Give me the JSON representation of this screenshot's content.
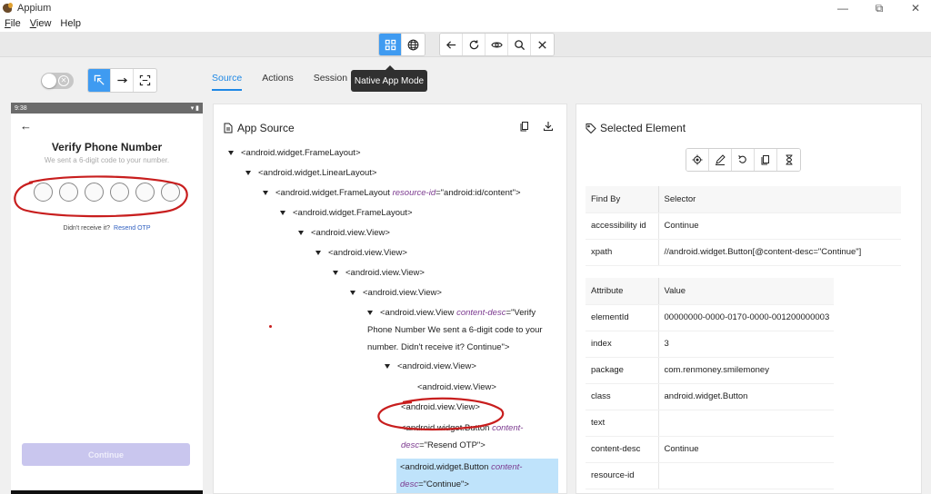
{
  "window": {
    "title": "Appium"
  },
  "menu": [
    {
      "accel": "F",
      "rest": "ile"
    },
    {
      "accel": "V",
      "rest": "iew"
    },
    {
      "accel": "",
      "rest": "Help"
    }
  ],
  "toolbar": {
    "tooltip": "Native App Mode",
    "mode_buttons": [
      "grid-icon",
      "globe-icon"
    ],
    "action_buttons": [
      "back-arrow-icon",
      "refresh-icon",
      "eye-icon",
      "search-icon",
      "close-icon"
    ],
    "accent_color": "#3f9bf1"
  },
  "tabs": [
    "Source",
    "Actions",
    "Session In"
  ],
  "phone": {
    "status_time": "9:38",
    "title": "Verify Phone Number",
    "subtitle": "We sent a 6-digit code to your number.",
    "otp_count": 6,
    "resend_text": "Didn't receive it?",
    "resend_link": "Resend OTP",
    "continue_label": "Continue"
  },
  "source": {
    "header": "App Source",
    "nodes": {
      "n1": "<android.widget.FrameLayout>",
      "n2": "<android.widget.LinearLayout>",
      "n3_pre": "<android.widget.FrameLayout ",
      "n3_attr": "resource-id",
      "n3_val": "=\"android:id/content\">",
      "n4": "<android.widget.FrameLayout>",
      "n5": "<android.view.View>",
      "n6": "<android.view.View>",
      "n7": "<android.view.View>",
      "n8": "<android.view.View>",
      "n9_pre": "<android.view.View ",
      "n9_attr": "content-desc",
      "n9_val": "=\"Verify Phone Number We sent a 6-digit code to your number. Didn't receive it? Continue\">",
      "n10": "<android.view.View>",
      "n11": "<android.view.View>",
      "n12": "<android.view.View>",
      "n13_pre": "<android.widget.Button ",
      "n13_attr": "content-desc",
      "n13_val": "=\"Resend OTP\">",
      "n14_pre": "<android.widget.Button ",
      "n14_attr": "content-desc",
      "n14_val": "=\"Continue\">"
    }
  },
  "selected": {
    "header": "Selected Element",
    "find_header": [
      "Find By",
      "Selector"
    ],
    "find_rows": [
      [
        "accessibility id",
        "Continue"
      ],
      [
        "xpath",
        "//android.widget.Button[@content-desc=\"Continue\"]"
      ]
    ],
    "attr_header": [
      "Attribute",
      "Value"
    ],
    "attr_rows": [
      [
        "elementId",
        "00000000-0000-0170-0000-001200000003"
      ],
      [
        "index",
        "3"
      ],
      [
        "package",
        "com.renmoney.smilemoney"
      ],
      [
        "class",
        "android.widget.Button"
      ],
      [
        "text",
        ""
      ],
      [
        "content-desc",
        "Continue"
      ],
      [
        "resource-id",
        ""
      ]
    ]
  }
}
